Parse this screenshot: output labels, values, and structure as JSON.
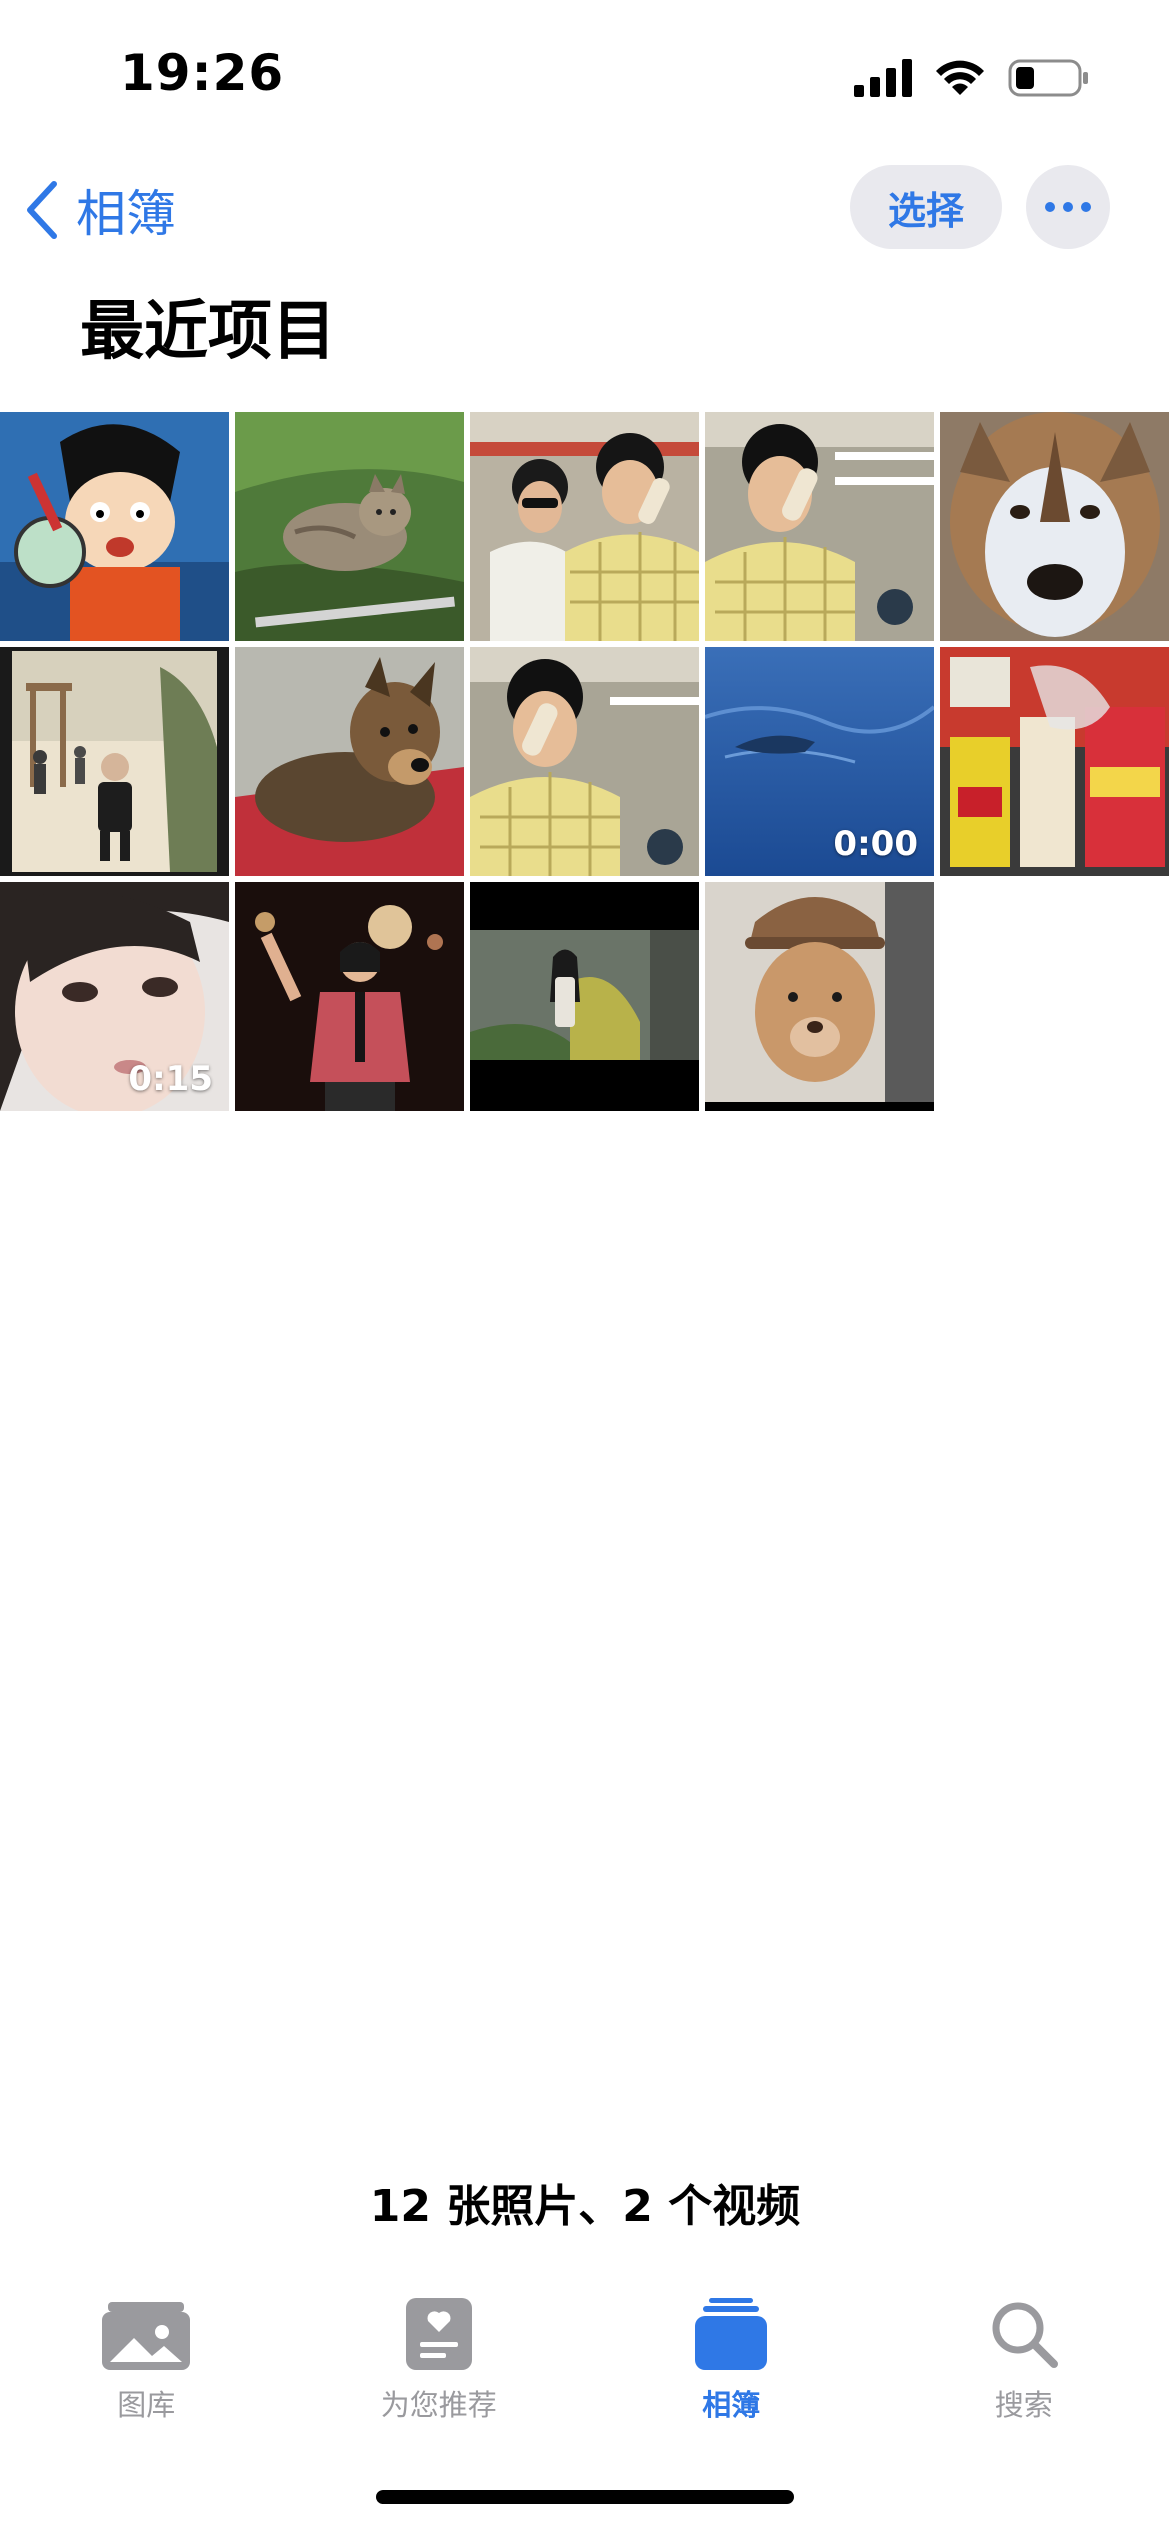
{
  "status_bar": {
    "time": "19:26"
  },
  "nav": {
    "back_label": "相簿",
    "select_label": "选择"
  },
  "page_title": "最近项目",
  "grid": {
    "tiles": [
      {
        "subject": "anime boy with hammer",
        "duration": ""
      },
      {
        "subject": "cat on grass",
        "duration": ""
      },
      {
        "subject": "man on phone with friend",
        "duration": ""
      },
      {
        "subject": "man on phone",
        "duration": ""
      },
      {
        "subject": "husky dog",
        "duration": ""
      },
      {
        "subject": "old photo of child in park",
        "duration": ""
      },
      {
        "subject": "shepherd dog on red carpet",
        "duration": ""
      },
      {
        "subject": "man on phone",
        "duration": ""
      },
      {
        "subject": "ocean water",
        "duration": "0:00"
      },
      {
        "subject": "snack packages",
        "duration": ""
      },
      {
        "subject": "girl portrait",
        "duration": "0:15"
      },
      {
        "subject": "singer on stage",
        "duration": ""
      },
      {
        "subject": "girl in field movie still",
        "duration": ""
      },
      {
        "subject": "dog wearing cap",
        "duration": ""
      }
    ]
  },
  "summary": "12 张照片、2 个视频",
  "tab_bar": {
    "tabs": [
      {
        "label": "图库",
        "icon": "photos-library-icon",
        "active": false
      },
      {
        "label": "为您推荐",
        "icon": "for-you-icon",
        "active": false
      },
      {
        "label": "相簿",
        "icon": "albums-icon",
        "active": true
      },
      {
        "label": "搜索",
        "icon": "search-icon",
        "active": false
      }
    ]
  },
  "colors": {
    "accent": "#2f78e6",
    "inactive": "#9a9a9e",
    "pill_bg": "#e9e9ee"
  }
}
